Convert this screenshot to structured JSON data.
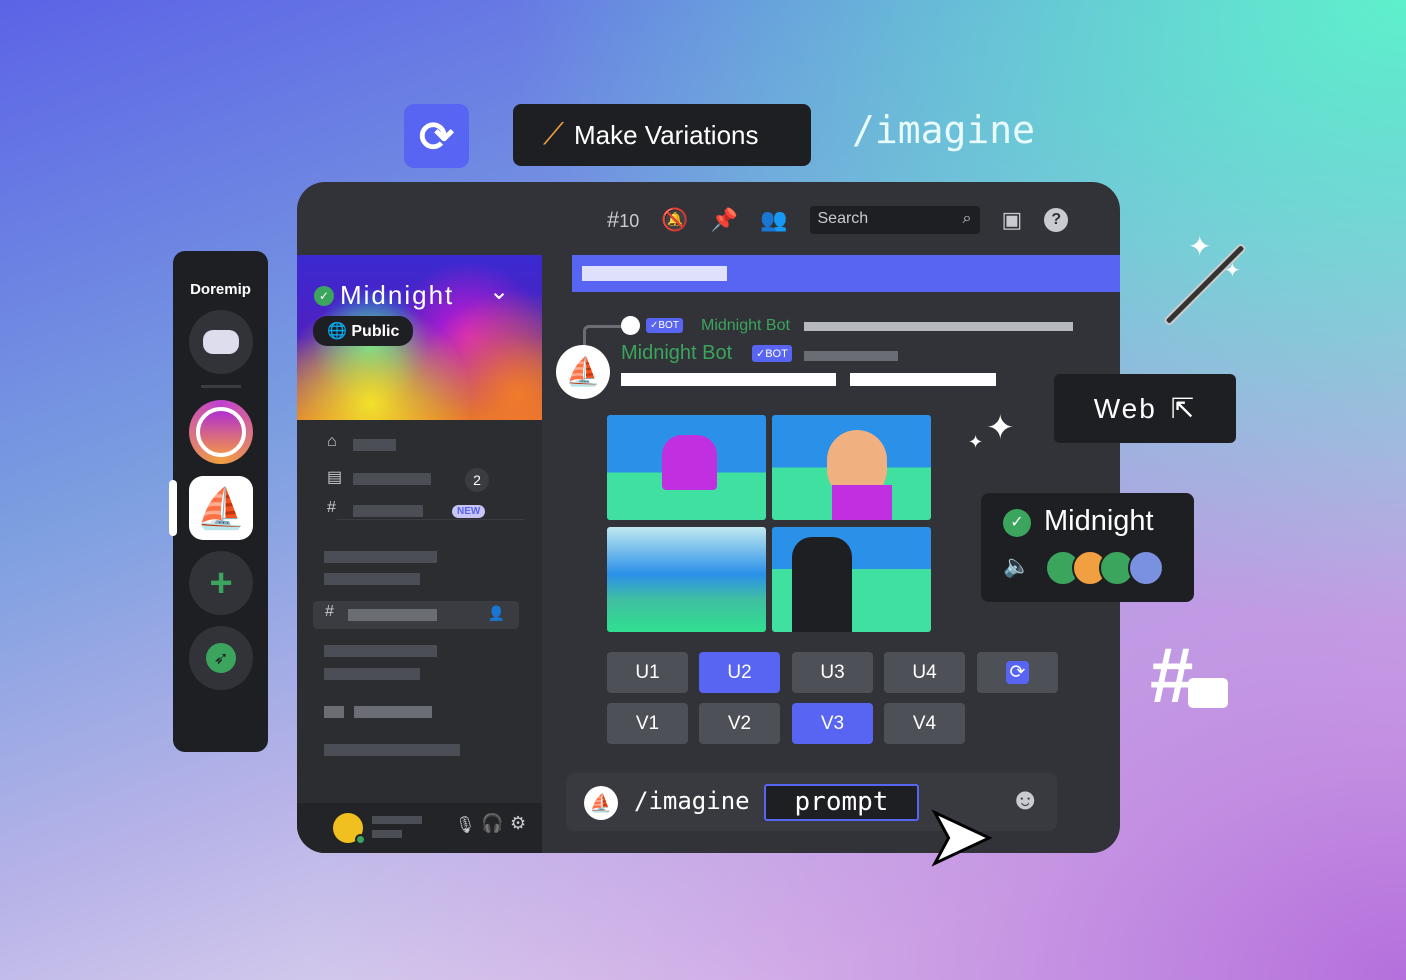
{
  "top": {
    "refresh_icon": "refresh-icon",
    "make_variations": "Make Variations",
    "wand_icon": "magic-wand-icon",
    "imagine": "/imagine"
  },
  "servers": {
    "title": "Doremip",
    "items": [
      "discord-home",
      "gradient-server",
      "midjourney-sailboat",
      "add-server",
      "explore"
    ]
  },
  "channel_sidebar": {
    "server_name": "Midnight",
    "visibility": "Public",
    "events_count": "2",
    "new_badge": "NEW"
  },
  "toolbar": {
    "threads_count": "10",
    "search_placeholder": "Search"
  },
  "messages": {
    "reply_author": "Midnight Bot",
    "bot_badge": "BOT",
    "author": "Midnight Bot"
  },
  "buttons": {
    "row1": [
      "U1",
      "U2",
      "U3",
      "U4"
    ],
    "row2": [
      "V1",
      "V2",
      "V3",
      "V4"
    ],
    "selected": [
      "U2",
      "V3"
    ]
  },
  "input": {
    "command": "/imagine",
    "prompt": "prompt"
  },
  "floating": {
    "web": "Web",
    "card_name": "Midnight"
  },
  "colors": {
    "accent": "#5865f2",
    "green": "#3ba55d",
    "dark": "#1e1f22",
    "window": "#313338"
  }
}
